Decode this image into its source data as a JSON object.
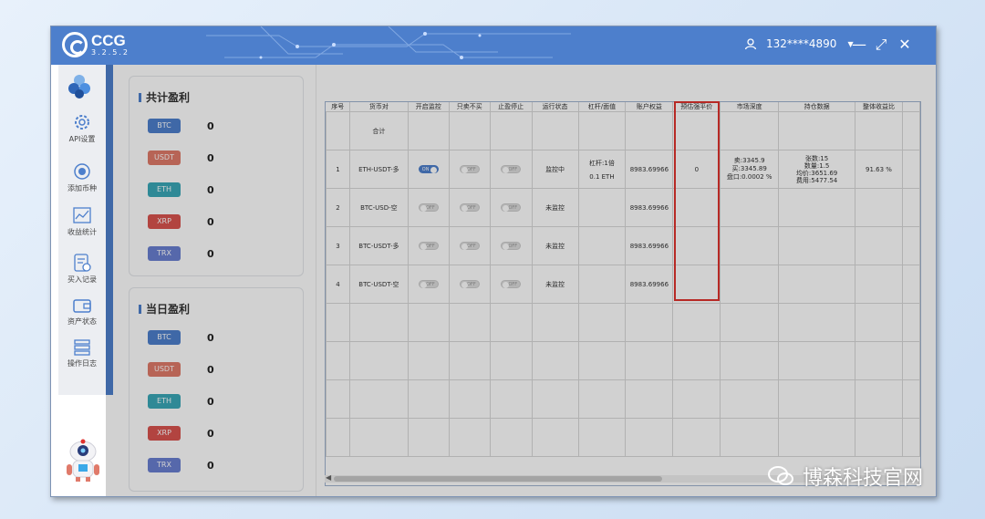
{
  "app": {
    "name": "CCG",
    "version": "3.2.5.2"
  },
  "user": {
    "account": "132****4890"
  },
  "window_controls": {
    "minimize": "—",
    "maximize": "⤢",
    "close": "✕"
  },
  "nav": [
    {
      "label": "API设置",
      "icon": "gear-icon"
    },
    {
      "label": "添加币种",
      "icon": "add-coin-icon"
    },
    {
      "label": "收益统计",
      "icon": "chart-icon"
    },
    {
      "label": "买入记录",
      "icon": "record-icon"
    },
    {
      "label": "资产状态",
      "icon": "wallet-icon"
    },
    {
      "label": "操作日志",
      "icon": "log-icon"
    }
  ],
  "total_profit": {
    "title": "共计盈利",
    "items": [
      {
        "coin": "BTC",
        "value": "0",
        "color": "#4d7fcc"
      },
      {
        "coin": "USDT",
        "value": "0",
        "color": "#e07a6a"
      },
      {
        "coin": "ETH",
        "value": "0",
        "color": "#3aa8b8"
      },
      {
        "coin": "XRP",
        "value": "0",
        "color": "#d9534f"
      },
      {
        "coin": "TRX",
        "value": "0",
        "color": "#6a7fd1"
      }
    ]
  },
  "daily_profit": {
    "title": "当日盈利",
    "items": [
      {
        "coin": "BTC",
        "value": "0",
        "color": "#4d7fcc"
      },
      {
        "coin": "USDT",
        "value": "0",
        "color": "#e07a6a"
      },
      {
        "coin": "ETH",
        "value": "0",
        "color": "#3aa8b8"
      },
      {
        "coin": "XRP",
        "value": "0",
        "color": "#d9534f"
      },
      {
        "coin": "TRX",
        "value": "0",
        "color": "#6a7fd1"
      }
    ]
  },
  "table": {
    "headers": [
      "序号",
      "货币对",
      "开启监控",
      "只卖不买",
      "止盈停止",
      "运行状态",
      "杠杆/面值",
      "账户权益",
      "预估强平价",
      "市场深度",
      "持仓数据",
      "整体收益比"
    ],
    "summary": {
      "label": "合计"
    },
    "toggle_on": "ON",
    "toggle_off": "OFF",
    "rows": [
      {
        "no": "1",
        "pair": "ETH-USDT-多",
        "monitor": "ON",
        "sell_only": "OFF",
        "tp_stop": "OFF",
        "status": "监控中",
        "leverage": "杠杆:1倍",
        "face": "0.1 ETH",
        "equity": "8983.69966",
        "liq_price": "0",
        "depth": [
          "卖:3345.9",
          "买:3345.89",
          "盘口:0.0002 %"
        ],
        "position": [
          "张数:15",
          "数量:1.5",
          "均价:3651.69",
          "费用:5477.54"
        ],
        "ratio": "91.63 %"
      },
      {
        "no": "2",
        "pair": "BTC-USD-空",
        "monitor": "OFF",
        "sell_only": "OFF",
        "tp_stop": "OFF",
        "status": "未监控",
        "leverage": "",
        "face": "",
        "equity": "8983.69966",
        "liq_price": "",
        "depth": [
          "",
          "",
          ""
        ],
        "position": [
          "",
          "",
          "",
          ""
        ],
        "ratio": ""
      },
      {
        "no": "3",
        "pair": "BTC-USDT-多",
        "monitor": "OFF",
        "sell_only": "OFF",
        "tp_stop": "OFF",
        "status": "未监控",
        "leverage": "",
        "face": "",
        "equity": "8983.69966",
        "liq_price": "",
        "depth": [
          "",
          "",
          ""
        ],
        "position": [
          "",
          "",
          "",
          ""
        ],
        "ratio": ""
      },
      {
        "no": "4",
        "pair": "BTC-USDT-空",
        "monitor": "OFF",
        "sell_only": "OFF",
        "tp_stop": "OFF",
        "status": "未监控",
        "leverage": "",
        "face": "",
        "equity": "8983.69966",
        "liq_price": "",
        "depth": [
          "",
          "",
          ""
        ],
        "position": [
          "",
          "",
          "",
          ""
        ],
        "ratio": ""
      }
    ]
  },
  "watermark": "博森科技官网"
}
